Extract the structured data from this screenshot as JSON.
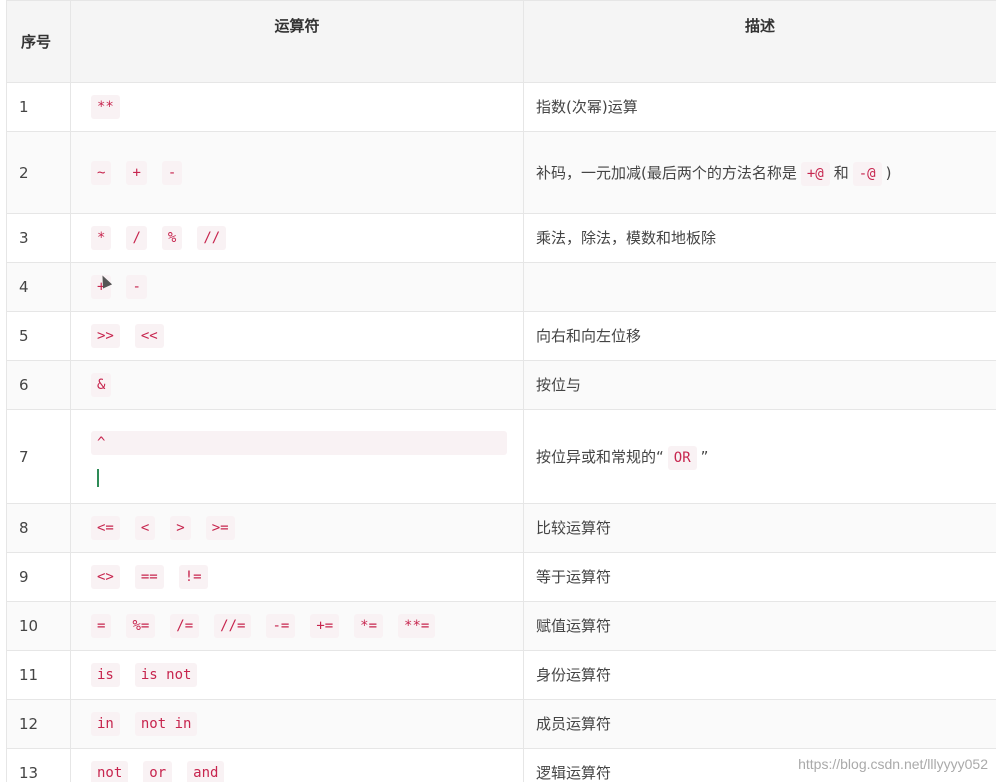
{
  "header": {
    "num": "序号",
    "operator": "运算符",
    "description": "描述"
  },
  "rows": [
    {
      "num": "1",
      "ops": [
        "**"
      ],
      "desc": "指数(次幂)运算"
    },
    {
      "num": "2",
      "ops": [
        "~",
        "+",
        "-"
      ],
      "desc_prefix": "补码，一元加减(最后两个的方法名称是",
      "desc_code1": "+@",
      "desc_mid": "和",
      "desc_code2": "-@",
      "desc_suffix": ")"
    },
    {
      "num": "3",
      "ops": [
        "*",
        "/",
        "%",
        "//"
      ],
      "desc": "乘法，除法，模数和地板除"
    },
    {
      "num": "4",
      "ops": [
        "+",
        "-"
      ],
      "desc": ""
    },
    {
      "num": "5",
      "ops": [
        ">>",
        "<<"
      ],
      "desc": "向右和向左位移"
    },
    {
      "num": "6",
      "ops": [
        "&"
      ],
      "desc": "按位与"
    },
    {
      "num": "7",
      "ops": [
        "^"
      ],
      "desc_prefix": "按位异或和常规的“",
      "desc_code1": "OR",
      "desc_suffix": "”"
    },
    {
      "num": "8",
      "ops": [
        "<=",
        "<",
        ">",
        ">="
      ],
      "desc": "比较运算符"
    },
    {
      "num": "9",
      "ops": [
        "<>",
        "==",
        "!="
      ],
      "desc": "等于运算符"
    },
    {
      "num": "10",
      "ops": [
        "=",
        "%=",
        "/=",
        "//=",
        "-=",
        "+=",
        "*=",
        "**="
      ],
      "desc": "赋值运算符"
    },
    {
      "num": "11",
      "ops": [
        "is",
        "is not"
      ],
      "desc": "身份运算符"
    },
    {
      "num": "12",
      "ops": [
        "in",
        "not in"
      ],
      "desc": "成员运算符"
    },
    {
      "num": "13",
      "ops": [
        "not",
        "or",
        "and"
      ],
      "desc": "逻辑运算符"
    }
  ],
  "watermark": "https://blog.csdn.net/lllyyyy052"
}
